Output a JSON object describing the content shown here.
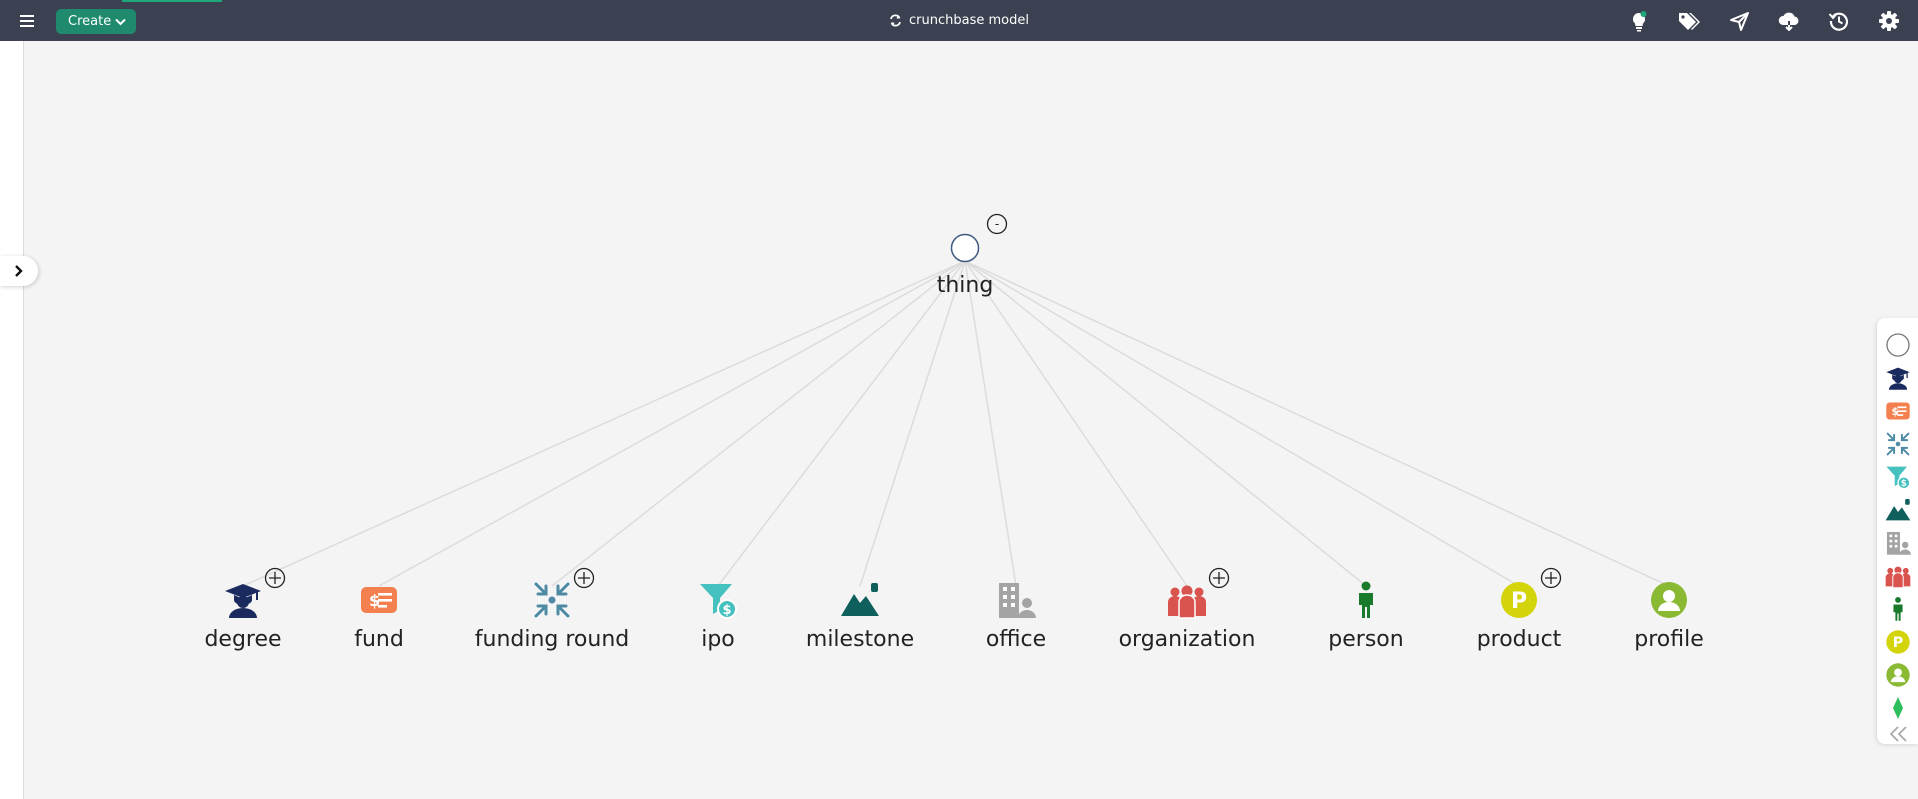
{
  "header": {
    "menu_icon": "hamburger-icon",
    "create_label": "Create",
    "title": "crunchbase model",
    "title_icon": "sync-icon",
    "tools": [
      "lightbulb-icon",
      "tags-icon",
      "send-icon",
      "cloud-icon",
      "history-icon",
      "gear-icon"
    ]
  },
  "graph": {
    "root": {
      "label": "thing",
      "collapse_symbol": "-"
    },
    "children": [
      {
        "label": "degree",
        "icon": "graduate-icon",
        "expandable": true,
        "color": "#1b2a5e"
      },
      {
        "label": "fund",
        "icon": "fund-card-icon",
        "expandable": false,
        "color": "#f47f4f"
      },
      {
        "label": "funding round",
        "icon": "compress-arrows-icon",
        "expandable": true,
        "color": "#4d8aa6"
      },
      {
        "label": "ipo",
        "icon": "funnel-dollar-icon",
        "expandable": false,
        "color": "#45c2c0"
      },
      {
        "label": "milestone",
        "icon": "mountain-icon",
        "expandable": false,
        "color": "#0f5f5c"
      },
      {
        "label": "office",
        "icon": "office-building-icon",
        "expandable": false,
        "color": "#a4a4a4"
      },
      {
        "label": "organization",
        "icon": "people-group-icon",
        "expandable": true,
        "color": "#d9534f"
      },
      {
        "label": "person",
        "icon": "person-icon",
        "expandable": false,
        "color": "#1a7a2c"
      },
      {
        "label": "product",
        "icon": "product-p-icon",
        "expandable": true,
        "color": "#d4d40b"
      },
      {
        "label": "profile",
        "icon": "profile-user-icon",
        "expandable": false,
        "color": "#8ab934"
      }
    ]
  },
  "palette": {
    "items": [
      "empty-circle-icon",
      "graduate-icon",
      "fund-card-icon",
      "compress-arrows-icon",
      "funnel-dollar-icon",
      "mountain-icon",
      "office-building-icon",
      "people-group-icon",
      "person-icon",
      "product-p-icon",
      "profile-user-icon",
      "diamond-icon"
    ],
    "collapse_icon": "double-chevron-left-icon"
  },
  "colors": {
    "header_bg": "#3b4150",
    "create_button": "#1f8a6e",
    "canvas_bg": "#f4f4f4",
    "edge": "#dcdcdc"
  }
}
